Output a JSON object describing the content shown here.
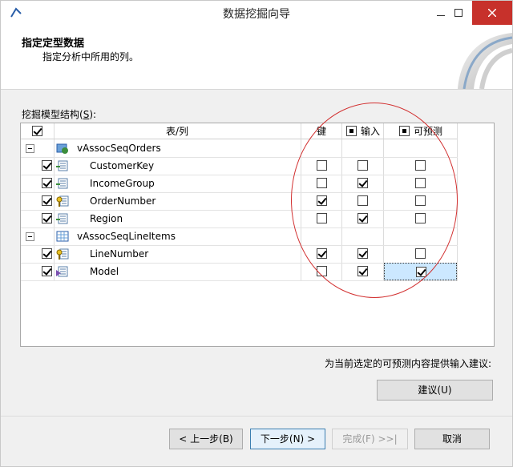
{
  "window": {
    "title": "数据挖掘向导"
  },
  "header": {
    "title": "指定定型数据",
    "subtitle": "指定分析中所用的列。"
  },
  "section_label": {
    "text": "挖掘模型结构(",
    "accel": "S",
    "suffix": "):"
  },
  "grid": {
    "columns": {
      "table_col": "表/列",
      "key": "键",
      "input": "输入",
      "predict": "可预测"
    },
    "tables": [
      {
        "name": "vAssocSeqOrders",
        "rows": [
          {
            "name": "CustomerKey",
            "included": true,
            "key": false,
            "input": false,
            "predict": false
          },
          {
            "name": "IncomeGroup",
            "included": true,
            "key": false,
            "input": true,
            "predict": false
          },
          {
            "name": "OrderNumber",
            "included": true,
            "key": true,
            "input": false,
            "predict": false
          },
          {
            "name": "Region",
            "included": true,
            "key": false,
            "input": true,
            "predict": false
          }
        ]
      },
      {
        "name": "vAssocSeqLineItems",
        "rows": [
          {
            "name": "LineNumber",
            "included": true,
            "key": true,
            "input": true,
            "predict": false
          },
          {
            "name": "Model",
            "included": true,
            "key": false,
            "input": true,
            "predict": true
          }
        ]
      }
    ]
  },
  "hint": {
    "text": "为当前选定的可预测内容提供输入建议:"
  },
  "buttons": {
    "suggest": "建议(U)",
    "back": "< 上一步(B)",
    "next": "下一步(N) >",
    "finish": "完成(F) >>|",
    "cancel": "取消"
  },
  "colors": {
    "close_button": "#c7312b",
    "annotation_ellipse": "#d23030",
    "selection": "#cce8ff",
    "primary_border": "#3c7fb1"
  }
}
